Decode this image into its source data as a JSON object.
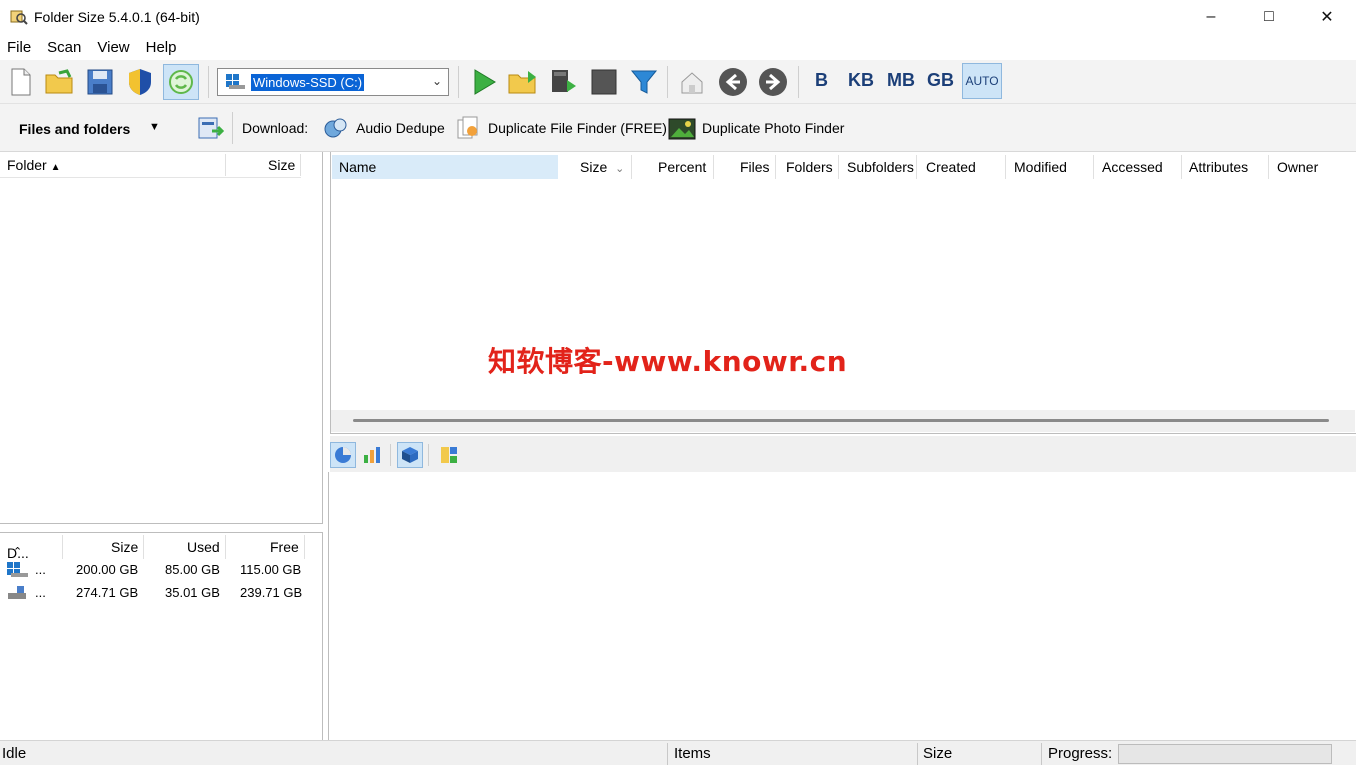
{
  "window": {
    "title": "Folder Size 5.4.0.1 (64-bit)"
  },
  "menu": [
    "File",
    "Scan",
    "View",
    "Help"
  ],
  "toolbar": {
    "drive_selected": "Windows-SSD (C:)",
    "units": [
      "B",
      "KB",
      "MB",
      "GB"
    ],
    "auto_label": "AUTO"
  },
  "toolbar2": {
    "view_label": "Files and folders",
    "download_label": "Download:",
    "links": [
      "Audio Dedupe",
      "Duplicate File Finder (FREE)",
      "Duplicate Photo Finder"
    ]
  },
  "folder_tree": {
    "col_folder": "Folder",
    "col_size": "Size"
  },
  "drives": {
    "columns": [
      "D...",
      "Size",
      "Used",
      "Free"
    ],
    "rows": [
      {
        "name": "...",
        "size": "200.00 GB",
        "used": "85.00 GB",
        "free": "115.00 GB"
      },
      {
        "name": "...",
        "size": "274.71 GB",
        "used": "35.01 GB",
        "free": "239.71 GB"
      }
    ]
  },
  "file_list": {
    "columns": [
      "Name",
      "Size",
      "Percent",
      "Files",
      "Folders",
      "Subfolders",
      "Created",
      "Modified",
      "Accessed",
      "Attributes",
      "Owner"
    ]
  },
  "watermark": "知软博客-www.knowr.cn",
  "status": {
    "state": "Idle",
    "items": "Items",
    "size": "Size",
    "progress_label": "Progress:"
  }
}
